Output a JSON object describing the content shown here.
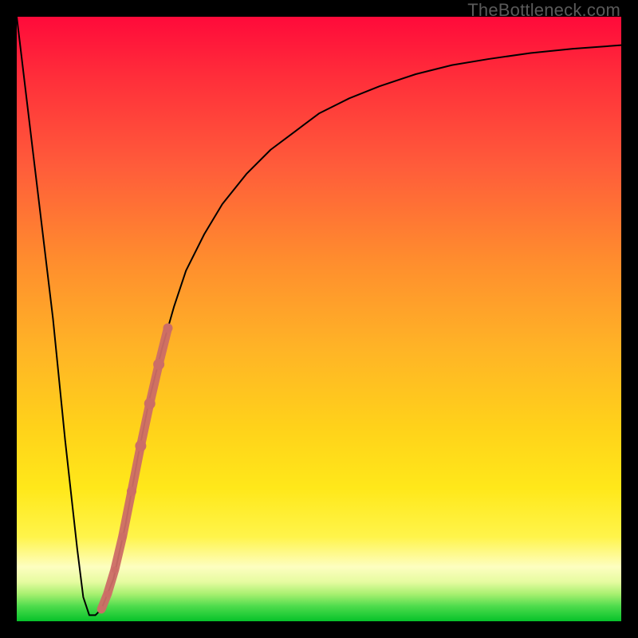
{
  "watermark": "TheBottleneck.com",
  "chart_data": {
    "type": "line",
    "title": "",
    "xlabel": "",
    "ylabel": "",
    "xlim": [
      0,
      100
    ],
    "ylim": [
      0,
      100
    ],
    "series": [
      {
        "name": "bottleneck-curve",
        "x": [
          0,
          3,
          6,
          8,
          10,
          11,
          12,
          13,
          14,
          16,
          18,
          20,
          22,
          24,
          26,
          28,
          31,
          34,
          38,
          42,
          46,
          50,
          55,
          60,
          66,
          72,
          78,
          85,
          92,
          100
        ],
        "y": [
          100,
          75,
          50,
          30,
          12,
          4,
          1,
          1,
          2,
          7,
          16,
          27,
          37,
          45,
          52,
          58,
          64,
          69,
          74,
          78,
          81,
          84,
          86.5,
          88.5,
          90.5,
          92,
          93,
          94,
          94.7,
          95.3
        ]
      }
    ],
    "markers": {
      "name": "highlight-segment",
      "points": [
        {
          "x": 14.0,
          "y": 2.0,
          "r": 4
        },
        {
          "x": 15.0,
          "y": 4.5,
          "r": 4
        },
        {
          "x": 16.2,
          "y": 8.5,
          "r": 4
        },
        {
          "x": 17.5,
          "y": 14.0,
          "r": 5
        },
        {
          "x": 19.0,
          "y": 21.5,
          "r": 6
        },
        {
          "x": 20.5,
          "y": 29.0,
          "r": 7
        },
        {
          "x": 22.0,
          "y": 36.0,
          "r": 7
        },
        {
          "x": 23.5,
          "y": 42.5,
          "r": 7
        },
        {
          "x": 25.0,
          "y": 48.5,
          "r": 6
        }
      ],
      "color": "#cc6d66"
    }
  }
}
